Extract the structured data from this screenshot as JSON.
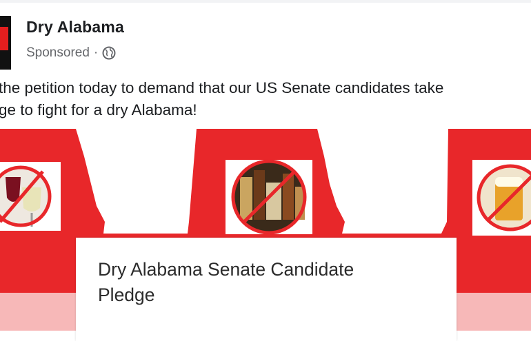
{
  "post": {
    "page_name": "Dry Alabama",
    "sponsored_label": "Sponsored",
    "separator": "·",
    "privacy_icon": "globe-icon",
    "text_line1": "the petition today to demand that our US Senate candidates take",
    "text_line2": "ge to fight for a dry Alabama!"
  },
  "link_card": {
    "title": "Dry Alabama Senate Candidate Pledge"
  },
  "banner": {
    "icons": [
      "no-wine-icon",
      "no-liquor-icon",
      "no-beer-icon"
    ]
  },
  "colors": {
    "brand_red": "#e8272a",
    "light_pink": "#f7b8b8",
    "text": "#1c1e21",
    "meta_gray": "#65676b"
  }
}
